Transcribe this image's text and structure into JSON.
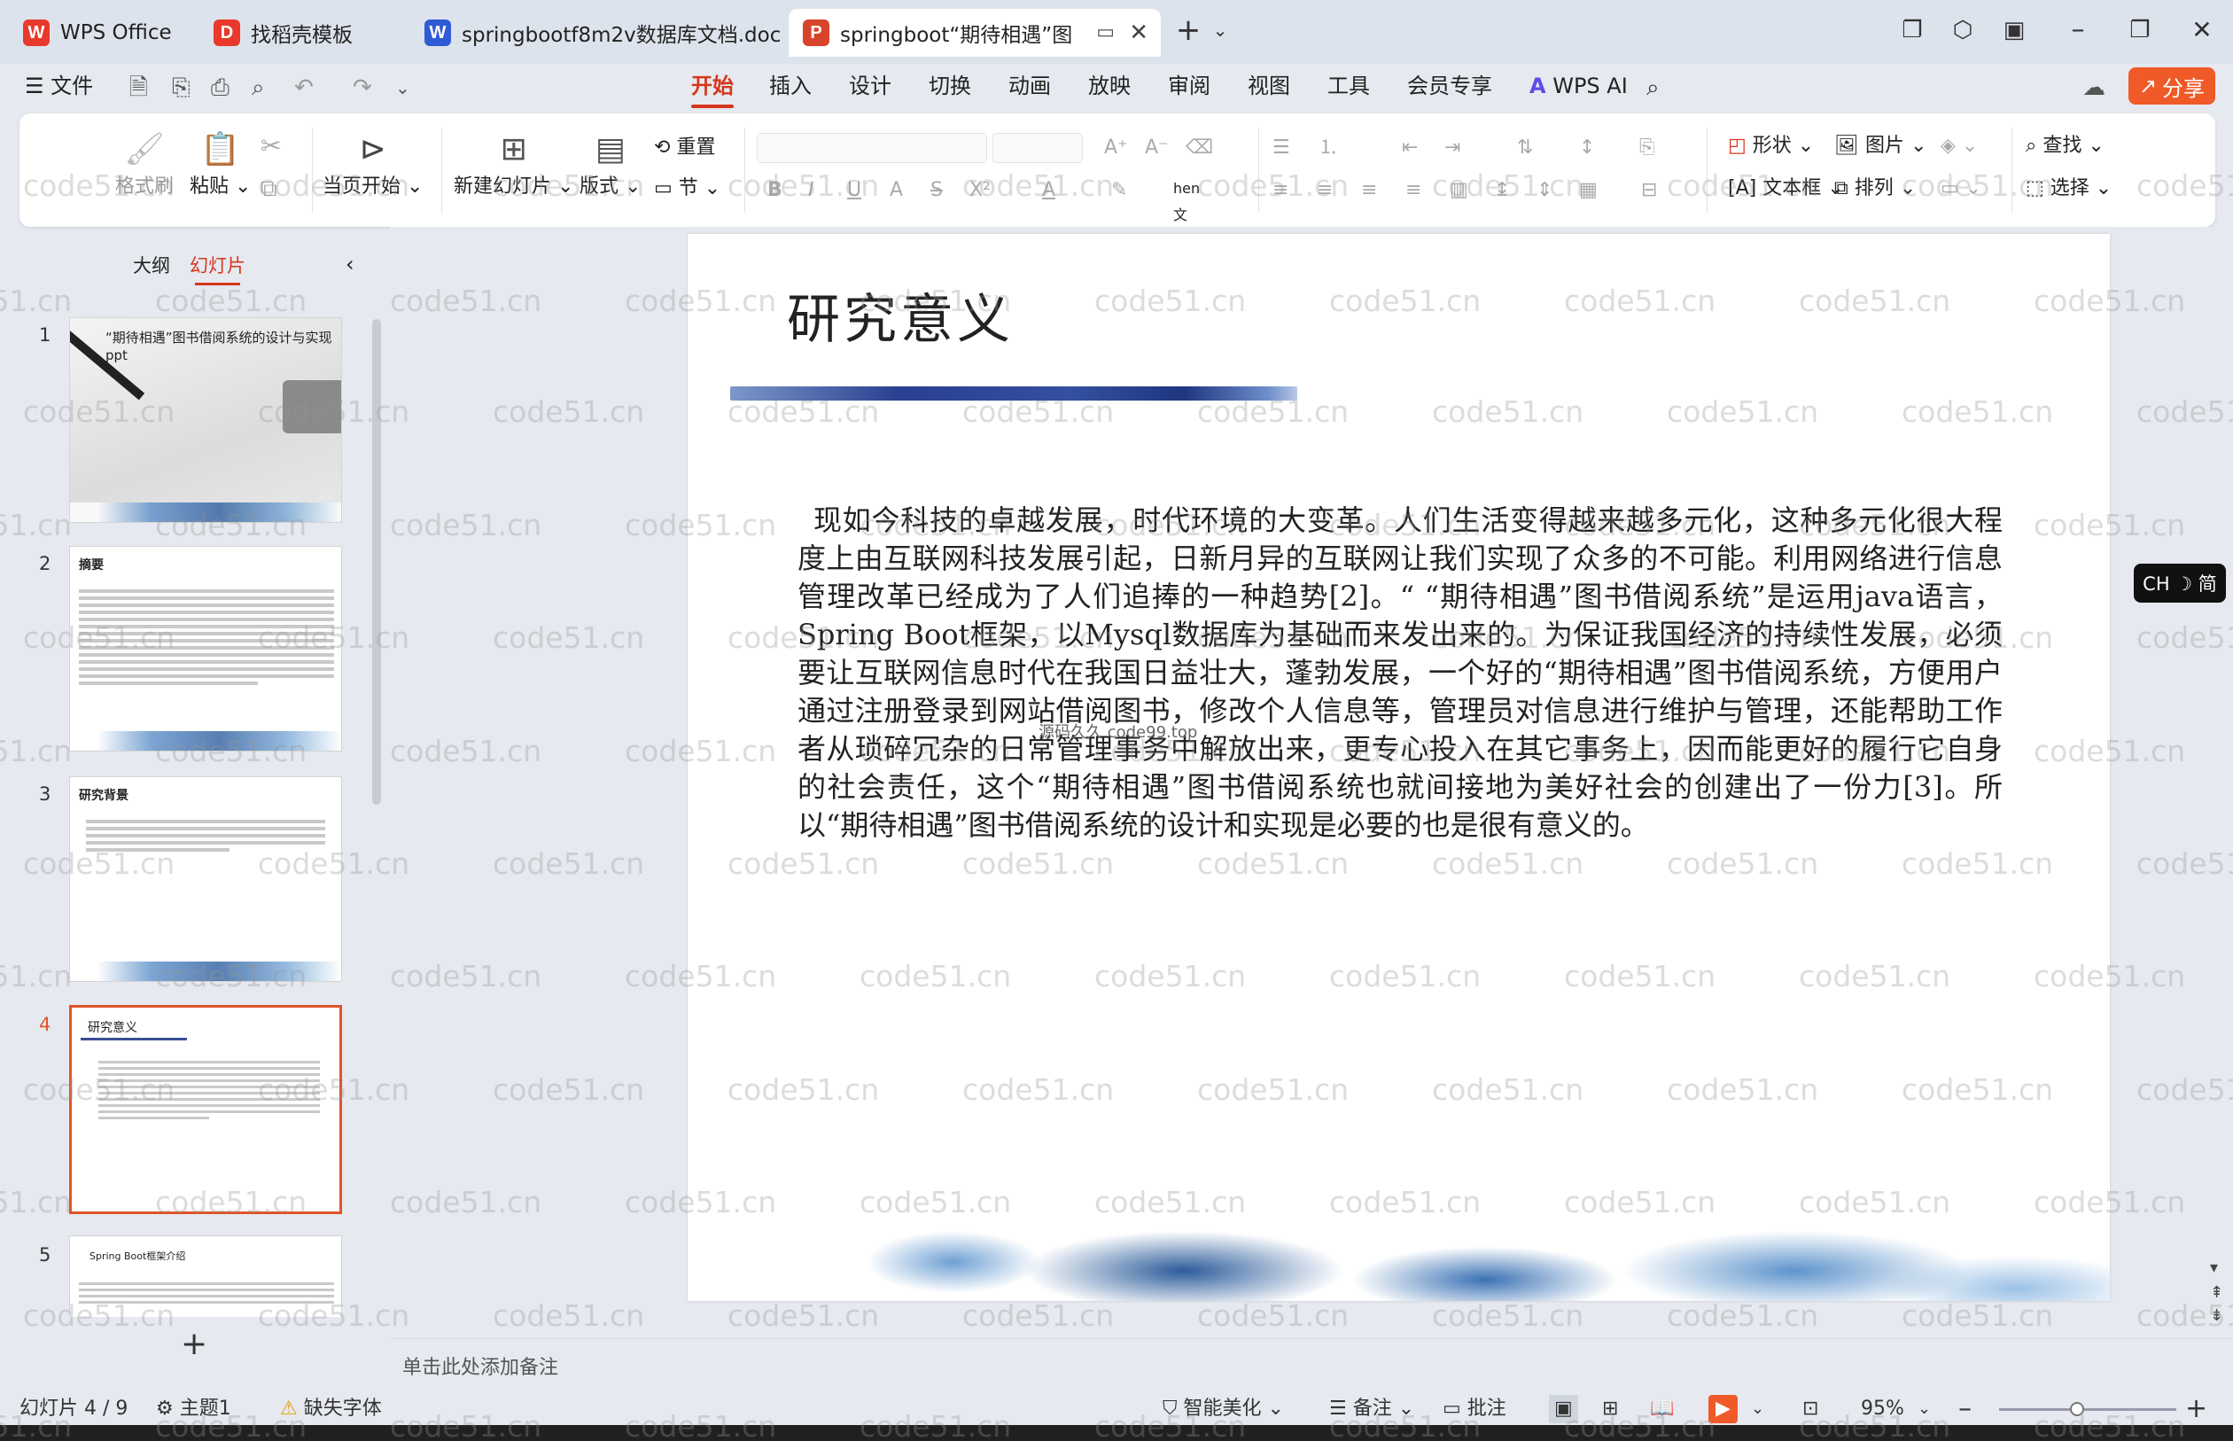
{
  "tabs": [
    {
      "label": "WPS Office",
      "logo": "W",
      "color": "#e8392a"
    },
    {
      "label": "找稻壳模板",
      "logo": "D",
      "color": "#e8392a"
    },
    {
      "label": "springbootf8m2v数据库文档.doc",
      "logo": "W",
      "color": "#2f5bd3"
    },
    {
      "label": "springboot“期待相遇”图",
      "logo": "P",
      "color": "#d8432b"
    }
  ],
  "menu": {
    "file": "文件",
    "items": [
      "开始",
      "插入",
      "设计",
      "切换",
      "动画",
      "放映",
      "审阅",
      "视图",
      "工具",
      "会员专享"
    ],
    "wps_ai": "WPS AI",
    "share": "分享"
  },
  "ribbon": {
    "format_painter": "格式刷",
    "paste": "粘贴",
    "play_from_current": "当页开始",
    "new_slide": "新建幻灯片",
    "layout": "版式",
    "reset": "重置",
    "section": "节",
    "shape": "形状",
    "picture": "图片",
    "find": "查找",
    "textbox": "文本框",
    "arrange": "排列",
    "select": "选择"
  },
  "panel": {
    "outline_tab": "大纲",
    "slides_tab": "幻灯片"
  },
  "thumbnails": [
    {
      "num": "1",
      "title": "“期待相遇”图书借阅系统的设计与实现ppt"
    },
    {
      "num": "2",
      "title": "摘要"
    },
    {
      "num": "3",
      "title": "研究背景"
    },
    {
      "num": "4",
      "title": "研究意义"
    },
    {
      "num": "5",
      "title": "Spring Boot框架介绍"
    }
  ],
  "slide": {
    "title": "研究意义",
    "body": "现如今科技的卓越发展，时代环境的大变革。人们生活变得越来越多元化，这种多元化很大程度上由互联网科技发展引起，日新月异的互联网让我们实现了众多的不可能。利用网络进行信息管理改革已经成为了人们追捧的一种趋势[2]。“ “期待相遇”图书借阅系统”是运用java语言，Spring Boot框架，以Mysql数据库为基础而来发出来的。为保证我国经济的持续性发展，必须要让互联网信息时代在我国日益壮大，蓬勃发展，一个好的“期待相遇”图书借阅系统，方便用户通过注册登录到网站借阅图书，修改个人信息等，管理员对信息进行维护与管理，还能帮助工作者从琐碎冗杂的日常管理事务中解放出来，更专心投入在其它事务上，因而能更好的履行它自身的社会责任，这个“期待相遇”图书借阅系统也就间接地为美好社会的创建出了一份力[3]。所以“期待相遇”图书借阅系统的设计和实现是必要的也是很有意义的。",
    "embedded_watermark": "源码久久 code99.top"
  },
  "notes_placeholder": "单击此处添加备注",
  "status": {
    "slide_counter": "幻灯片 4 / 9",
    "theme": "主题1",
    "missing_font": "缺失字体",
    "smart_beautify": "智能美化",
    "notes": "备注",
    "comments": "批注",
    "zoom": "95%"
  },
  "ime": "CH ☽ 简",
  "watermark_text": "code51.cn"
}
